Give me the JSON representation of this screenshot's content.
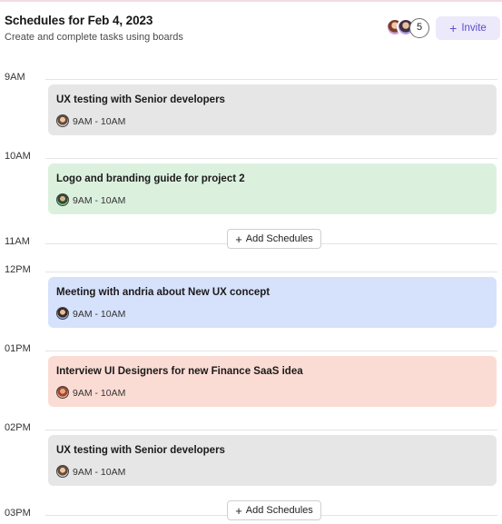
{
  "header": {
    "title": "Schedules for Feb 4, 2023",
    "subtitle": "Create and complete tasks using boards",
    "members_extra_count": "5",
    "invite_label": "Invite",
    "invite_icon": "plus-icon"
  },
  "hours": [
    "9AM",
    "10AM",
    "11AM",
    "12PM",
    "01PM",
    "02PM",
    "03PM"
  ],
  "events": [
    {
      "title": "UX testing with Senior developers",
      "time": "9AM - 10AM",
      "color": "#e6e6e6"
    },
    {
      "title": "Logo and branding guide for project 2",
      "time": "9AM - 10AM",
      "color": "#dcf0de"
    },
    {
      "title": "Meeting with andria about New UX concept",
      "time": "9AM - 10AM",
      "color": "#d6e1fc"
    },
    {
      "title": "Interview UI Designers for new Finance SaaS idea",
      "time": "9AM - 10AM",
      "color": "#fbdcd4"
    },
    {
      "title": "UX testing with Senior developers",
      "time": "9AM - 10AM",
      "color": "#e6e6e6"
    }
  ],
  "add_schedule_label": "Add Schedules",
  "accent_color": "#5b4ec9"
}
